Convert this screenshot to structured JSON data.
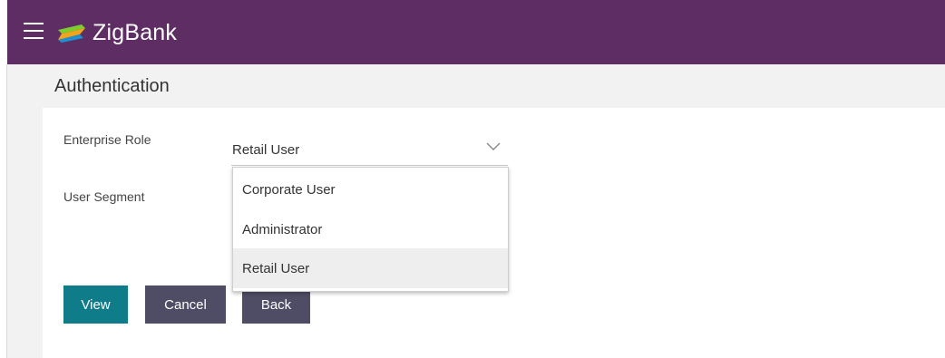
{
  "header": {
    "brand": "ZigBank",
    "menu_icon": "hamburger-menu-icon",
    "logo_icon": "zigbank-logo-icon",
    "background_color": "#5e2d63"
  },
  "page": {
    "title": "Authentication"
  },
  "form": {
    "enterprise_role_label": "Enterprise Role",
    "enterprise_role_value": "Retail User",
    "user_segment_label": "User Segment"
  },
  "dropdown": {
    "options": [
      "Corporate User",
      "Administrator",
      "Retail User"
    ],
    "selected_index": 2
  },
  "buttons": {
    "view": "View",
    "cancel": "Cancel",
    "back": "Back"
  },
  "colors": {
    "primary_button": "#0e7d89",
    "secondary_button": "#4f4d66"
  }
}
